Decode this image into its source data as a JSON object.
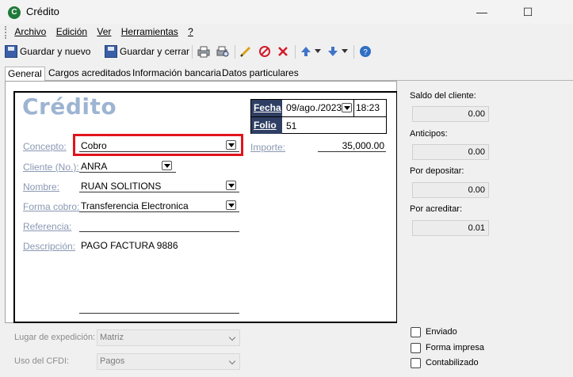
{
  "window": {
    "title": "Crédito",
    "minimize_glyph": "—",
    "maximize_glyph": "☐"
  },
  "menu": [
    "Archivo",
    "Edición",
    "Ver",
    "Herramientas",
    "?"
  ],
  "toolbar": {
    "save_new": "Guardar y nuevo",
    "save_close": "Guardar y cerrar"
  },
  "tabs": [
    "General",
    "Cargos acreditados",
    "Información bancaria",
    "Datos particulares"
  ],
  "form": {
    "title": "Crédito",
    "fecha_label": "Fecha",
    "fecha_value": "09/ago./2023",
    "hora_value": "18:23",
    "folio_label": "Folio",
    "folio_value": "51",
    "concepto_label": "Concepto:",
    "concepto_value": "Cobro",
    "importe_label": "Importe:",
    "importe_value": "35,000.00",
    "cliente_label": "Cliente (No.):",
    "cliente_value": "ANRA",
    "nombre_label": "Nombre:",
    "nombre_value": "RUAN SOLITIONS",
    "forma_cobro_label": "Forma cobro:",
    "forma_cobro_value": "Transferencia Electronica",
    "referencia_label": "Referencia:",
    "referencia_value": "",
    "descripcion_label": "Descripción:",
    "descripcion_value": "PAGO FACTURA 9886"
  },
  "side": {
    "saldo_label": "Saldo del cliente:",
    "saldo_value": "0.00",
    "anticipos_label": "Anticipos:",
    "anticipos_value": "0.00",
    "por_depositar_label": "Por depositar:",
    "por_depositar_value": "0.00",
    "por_acreditar_label": "Por acreditar:",
    "por_acreditar_value": "0.01"
  },
  "bottom": {
    "lugar_label": "Lugar de expedición:",
    "lugar_value": "Matriz",
    "cfdi_label": "Uso del CFDI:",
    "cfdi_value": "Pagos"
  },
  "checks": [
    {
      "label": "Enviado",
      "checked": false
    },
    {
      "label": "Forma impresa",
      "checked": false
    },
    {
      "label": "Contabilizado",
      "checked": false
    }
  ],
  "colors": {
    "accent_title": "#9db4d2",
    "label_header": "#2f3e63",
    "highlight": "#e0141e"
  }
}
